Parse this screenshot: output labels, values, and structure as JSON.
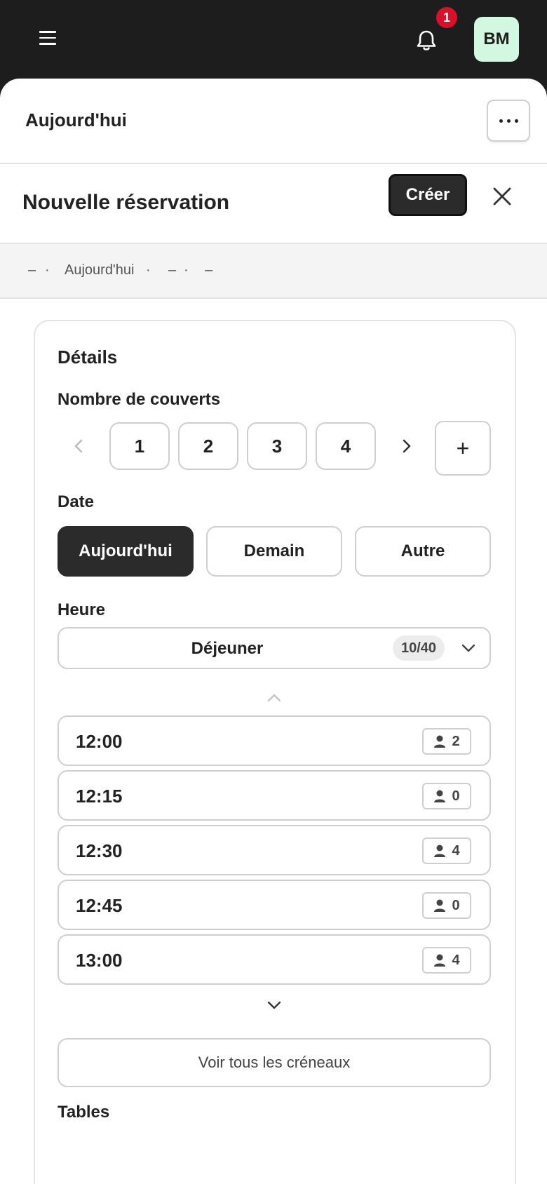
{
  "topbar": {
    "notifications_count": "1",
    "avatar_initials": "BM",
    "colors": {
      "bar": "#1d1d1d",
      "badge": "#d9102a",
      "avatar_bg": "#d3f8e2"
    }
  },
  "day_header": {
    "title": "Aujourd'hui"
  },
  "reservation_header": {
    "title": "Nouvelle réservation",
    "create_label": "Créer"
  },
  "summary": {
    "dash1": "–",
    "dot1": "·",
    "day": "Aujourd'hui",
    "dot2": "·",
    "dash2": "–",
    "dot3": "·",
    "dash3": "–"
  },
  "details": {
    "title": "Détails",
    "covers_label": "Nombre de couverts",
    "covers": [
      "1",
      "2",
      "3",
      "4"
    ],
    "plus_label": "+",
    "date_label": "Date",
    "date_options": [
      "Aujourd'hui",
      "Demain",
      "Autre"
    ],
    "date_selected": "Aujourd'hui",
    "time_label": "Heure",
    "meal": {
      "name": "Déjeuner",
      "count": "10/40"
    },
    "slots": [
      {
        "time": "12:00",
        "guests": "2"
      },
      {
        "time": "12:15",
        "guests": "0"
      },
      {
        "time": "12:30",
        "guests": "4"
      },
      {
        "time": "12:45",
        "guests": "0"
      },
      {
        "time": "13:00",
        "guests": "4"
      }
    ],
    "see_all_label": "Voir tous les créneaux",
    "tables_label": "Tables"
  }
}
